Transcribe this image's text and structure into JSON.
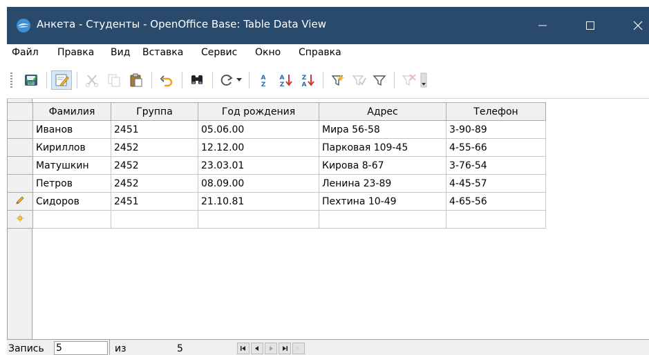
{
  "window": {
    "title": "Анкета - Студенты - OpenOffice Base: Table Data View",
    "colors": {
      "titlebar": "#2a4a6b",
      "title_text": "#ffffff"
    }
  },
  "menu": {
    "items": [
      {
        "label": "Файл"
      },
      {
        "label": "Правка"
      },
      {
        "label": "Вид"
      },
      {
        "label": "Вставка"
      },
      {
        "label": "Сервис"
      },
      {
        "label": "Окно"
      },
      {
        "label": "Справка"
      }
    ]
  },
  "toolbar": {
    "buttons": [
      {
        "icon": "save-record-icon"
      },
      {
        "icon": "edit-data-icon",
        "active": true
      },
      {
        "icon": "cut-icon",
        "enabled": false
      },
      {
        "icon": "copy-icon",
        "enabled": false
      },
      {
        "icon": "paste-icon"
      },
      {
        "icon": "undo-icon"
      },
      {
        "icon": "find-record-icon"
      },
      {
        "icon": "refresh-icon"
      },
      {
        "icon": "sort-icon"
      },
      {
        "icon": "sort-ascending-icon"
      },
      {
        "icon": "sort-descending-icon"
      },
      {
        "icon": "autofilter-icon"
      },
      {
        "icon": "apply-filter-icon",
        "enabled": false
      },
      {
        "icon": "standard-filter-icon"
      },
      {
        "icon": "remove-filter-icon",
        "enabled": false
      }
    ]
  },
  "table": {
    "columns": [
      "Фамилия",
      "Группа",
      "Год рождения",
      "Адрес",
      "Телефон"
    ],
    "rows": [
      [
        "Иванов",
        "2451",
        "05.06.00",
        "Мира 56-58",
        "3-90-89"
      ],
      [
        "Кириллов",
        "2452",
        "12.12.00",
        "Парковая 109-45",
        "4-55-66"
      ],
      [
        "Матушкин",
        "2452",
        "23.03.01",
        "Кирова 8-67",
        "3-76-54"
      ],
      [
        "Петров",
        "2452",
        "08.09.00",
        "Ленина 23-89",
        "4-45-57"
      ],
      [
        "Сидоров",
        "2451",
        "21.10.81",
        "Пехтина 10-49",
        "4-65-56"
      ]
    ],
    "current_row_icon": "pencil-edit-icon",
    "new_row_icon": "new-record-star-icon"
  },
  "status": {
    "record_label": "Запись",
    "record_value": "5",
    "of_label": "из",
    "total": "5"
  }
}
